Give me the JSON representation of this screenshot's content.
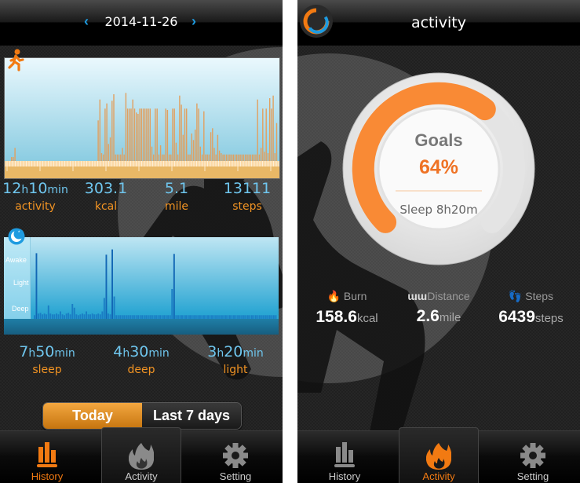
{
  "history_screen": {
    "date": "2014-11-26",
    "prev_icon": "chevron-left-icon",
    "next_icon": "chevron-right-icon",
    "activity_chart": {
      "icon": "walking-person-icon",
      "bar_color": "#e0a060",
      "values": [
        3,
        3,
        10,
        0,
        0,
        0,
        0,
        0,
        0,
        0,
        0,
        0,
        0,
        0,
        0,
        0,
        0,
        0,
        0,
        0,
        0,
        0,
        0,
        0,
        0,
        0,
        0,
        0,
        0,
        0,
        0,
        0,
        0,
        0,
        0,
        0,
        0,
        0,
        0,
        0,
        0,
        0,
        0,
        0,
        0,
        0,
        0,
        0,
        0,
        0,
        31,
        47,
        6,
        5,
        40,
        44,
        13,
        18,
        46,
        51,
        5,
        5,
        5,
        5,
        10,
        5,
        52,
        40,
        40,
        40,
        47,
        40,
        37,
        36,
        40,
        40,
        40,
        40,
        40,
        40,
        40,
        11,
        5,
        40,
        40,
        5,
        12,
        5,
        5,
        40,
        39,
        5,
        5,
        40,
        40,
        14,
        5,
        50,
        43,
        20,
        40,
        40,
        5,
        5,
        21,
        16,
        24,
        44,
        40,
        11,
        5,
        38,
        5,
        5,
        5,
        22,
        25,
        10,
        5,
        20,
        8,
        6,
        5,
        5,
        5,
        5,
        5,
        5,
        5,
        5,
        5,
        5,
        5,
        5,
        5,
        5,
        5,
        5,
        5,
        5,
        5,
        5,
        47,
        5,
        10,
        40,
        7,
        40,
        6,
        48,
        40,
        50,
        6,
        29
      ]
    },
    "activity_stats": [
      {
        "value": "12",
        "unit1": "h",
        "value2": "10",
        "unit2": "min",
        "label": "activity"
      },
      {
        "value": "303.1",
        "label": "kcal"
      },
      {
        "value": "5.1",
        "label": "mile"
      },
      {
        "value": "13111",
        "label": "steps"
      }
    ],
    "sleep_chart": {
      "icon": "moon-icon",
      "levels": [
        "Awake",
        "Light",
        "Deep"
      ],
      "values": [
        0.05,
        0.88,
        0.07,
        0.08,
        0.06,
        0.07,
        0.06,
        0.18,
        0.07,
        0.06,
        0.06,
        0.07,
        0.06,
        0.1,
        0.06,
        0.05,
        0.07,
        0.08,
        0.06,
        0.2,
        0.15,
        0.06,
        0.05,
        0.06,
        0.07,
        0.06,
        0.1,
        0.06,
        0.06,
        0.07,
        0.06,
        0.06,
        0.07,
        0.06,
        0.1,
        0.28,
        0.86,
        0.07,
        0.06,
        0.93,
        0.3,
        0.05,
        0.05,
        0.05,
        0.05,
        0.05,
        0.05,
        0.05,
        0.05,
        0.05,
        0.05,
        0.05,
        0.05,
        0.05,
        0.05,
        0.05,
        0.05,
        0.05,
        0.05,
        0.05,
        0.05,
        0.05,
        0.05,
        0.05,
        0.05,
        0.05,
        0.05,
        0.05,
        0.05,
        0.4,
        0.87,
        0.05,
        0.05,
        0.05,
        0.05,
        0.05,
        0.05,
        0.05,
        0.05,
        0.05,
        0.05,
        0.05,
        0.05,
        0.05,
        0.05,
        0.05,
        0.05,
        0.05,
        0.05,
        0.05,
        0.05,
        0.05,
        0.05,
        0.05,
        0.05,
        0.05,
        0.05,
        0.05,
        0.05,
        0.05,
        0.05,
        0.05,
        0.05,
        0.05,
        0.05,
        0.05,
        0.05,
        0.05,
        0.05,
        0.05,
        0.05,
        0.05,
        0.05,
        0.05,
        0.05,
        0.05,
        0.05,
        0.05,
        0.05,
        0.05,
        0.05,
        0.05
      ]
    },
    "sleep_stats": [
      {
        "hours": "7",
        "minutes": "50",
        "label": "sleep"
      },
      {
        "hours": "4",
        "minutes": "30",
        "label": "deep"
      },
      {
        "hours": "3",
        "minutes": "20",
        "label": "light"
      }
    ],
    "units": {
      "h": "h",
      "min": "min"
    },
    "segment": {
      "today": "Today",
      "last7": "Last 7 days",
      "selected": "Today"
    },
    "tabs": [
      {
        "label": "History",
        "icon": "bar-chart-icon",
        "active": true
      },
      {
        "label": "Activity",
        "icon": "flame-icon",
        "active": false
      },
      {
        "label": "Setting",
        "icon": "gear-icon",
        "active": false
      }
    ]
  },
  "activity_screen": {
    "title": "activity",
    "logo_icon": "app-logo-icon",
    "goals": {
      "label": "Goals",
      "percent_text": "64%",
      "progress": 0.64,
      "sleep_text": "Sleep 8h20m"
    },
    "metrics": [
      {
        "icon": "flame-icon",
        "label": "Burn",
        "value": "158.6",
        "unit": "kcal"
      },
      {
        "icon": "ruler-icon",
        "label": "Distance",
        "value": "2.6",
        "unit": "mile"
      },
      {
        "icon": "footprints-icon",
        "label": "Steps",
        "value": "6439",
        "unit": "steps"
      }
    ],
    "tabs": [
      {
        "label": "History",
        "icon": "bar-chart-icon",
        "active": false
      },
      {
        "label": "Activity",
        "icon": "flame-icon",
        "active": true
      },
      {
        "label": "Setting",
        "icon": "gear-icon",
        "active": false
      }
    ]
  },
  "colors": {
    "accent_orange": "#f27a12",
    "accent_blue": "#1e9be0",
    "value_blue": "#6fc6ee",
    "label_orange": "#f19323"
  }
}
